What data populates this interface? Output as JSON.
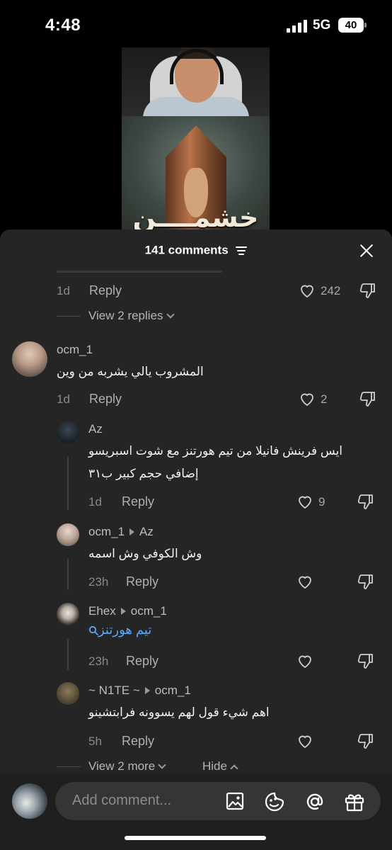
{
  "status_bar": {
    "time": "4:48",
    "network": "5G",
    "battery": "40"
  },
  "video": {
    "title_text": "خشمــــن"
  },
  "sheet": {
    "comment_count": "141 comments",
    "top_comment": {
      "age": "1d",
      "reply_label": "Reply",
      "likes": "242"
    },
    "view_replies": "View 2 replies",
    "comments": [
      {
        "username": "ocm_1",
        "text": "المشروب يالي يشربه من وين",
        "age": "1d",
        "reply_label": "Reply",
        "likes": "2"
      }
    ],
    "replies": [
      {
        "username": "Az",
        "reply_to": "",
        "text_lines": [
          "ايس فرينش فانيلا من تيم هورتنز مع شوت اسبريسو",
          "إضافي حجم كبير ب٣١"
        ],
        "age": "1d",
        "reply_label": "Reply",
        "likes": "9"
      },
      {
        "username": "ocm_1",
        "reply_to": "Az",
        "text_lines": [
          "وش الكوفي وش اسمه"
        ],
        "age": "23h",
        "reply_label": "Reply",
        "likes": ""
      },
      {
        "username": "Ehex",
        "reply_to": "ocm_1",
        "text_lines": [
          "تيم هورتنز"
        ],
        "age": "23h",
        "reply_label": "Reply",
        "likes": ""
      },
      {
        "username": "~ N1TE ~",
        "reply_to": "ocm_1",
        "text_lines": [
          "اهم شيء قول لهم يسوونه فرابتشينو"
        ],
        "age": "5h",
        "reply_label": "Reply",
        "likes": ""
      }
    ],
    "view_more": "View 2 more",
    "hide": "Hide"
  },
  "composer": {
    "placeholder": "Add comment..."
  },
  "colors": {
    "sheet_bg": "#252525",
    "link_blue": "#5aa9f5",
    "muted": "#8a8a8a"
  },
  "icons": [
    "heart-icon",
    "dislike-icon",
    "filter-icon",
    "close-icon",
    "image-icon",
    "sticker-icon",
    "mention-icon",
    "gift-icon",
    "search-icon"
  ]
}
